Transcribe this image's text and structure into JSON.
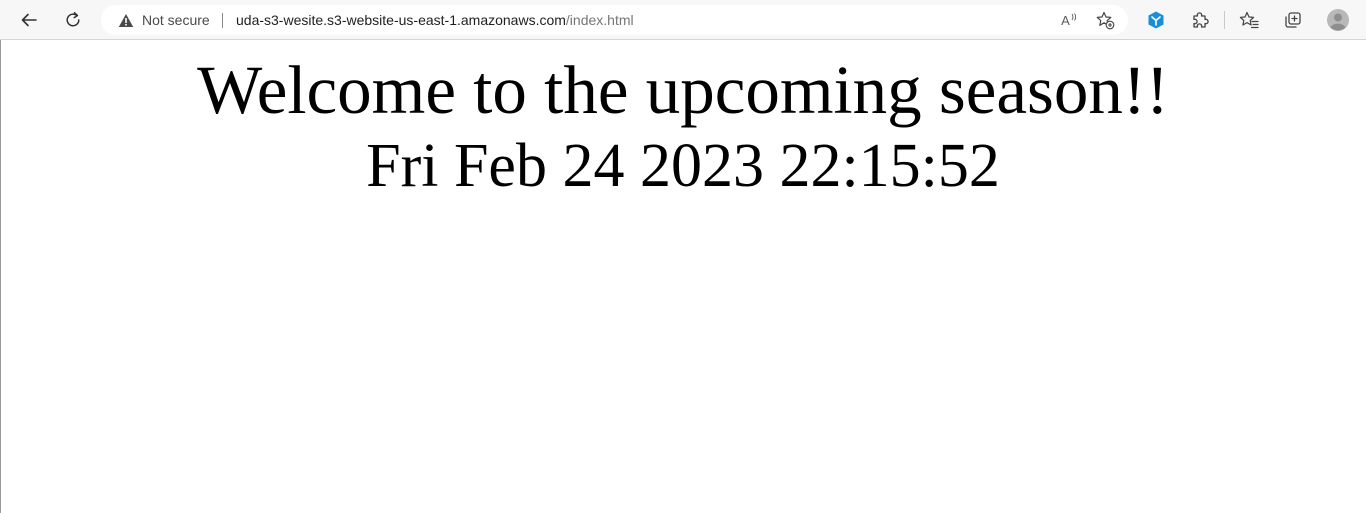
{
  "toolbar": {
    "back_icon": "back-arrow-icon",
    "refresh_icon": "refresh-icon",
    "address": {
      "security_icon": "warning-icon",
      "security_text": "Not secure",
      "url_host": "uda-s3-wesite.s3-website-us-east-1.amazonaws.com",
      "url_path": "/index.html"
    },
    "read_aloud_text": "A",
    "extensions": [
      "favorite-add-icon",
      "extension-blue-icon",
      "extensions-puzzle-icon",
      "favorites-icon",
      "collections-icon",
      "profile-icon"
    ],
    "accent_color": "#1a8fd6"
  },
  "page": {
    "heading": "Welcome to the upcoming season!!",
    "datetime": "Fri Feb 24 2023 22:15:52"
  }
}
